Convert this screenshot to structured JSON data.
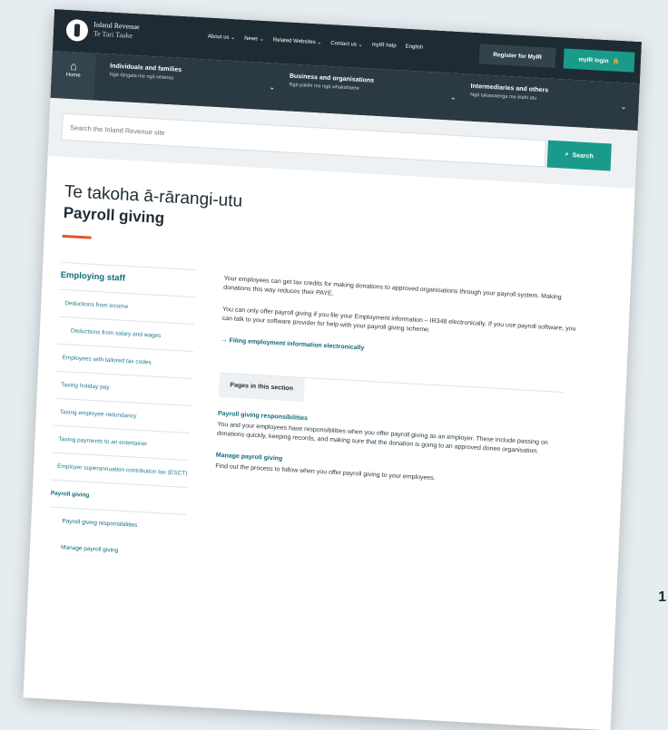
{
  "header": {
    "logo_title": "Inland Revenue",
    "logo_subtitle": "Te Tari Taake",
    "nav": [
      "About us ⌄",
      "News ⌄",
      "Related Websites ⌄",
      "Contact us ⌄",
      "myIR help",
      "English"
    ],
    "register_label": "Register for MyIR",
    "login_label": "myIR login"
  },
  "categories": {
    "home_label": "Home",
    "items": [
      {
        "title": "Individuals and families",
        "subtitle": "Ngā tāngata me ngā whānau"
      },
      {
        "title": "Business and organisations",
        "subtitle": "Ngā pakihi me ngā whakahaere"
      },
      {
        "title": "Intermediaries and others",
        "subtitle": "Ngā takawaenga me ētahi atu"
      }
    ]
  },
  "search": {
    "placeholder": "Search the Inland Revenue site",
    "button_label": "Search"
  },
  "title": {
    "maori": "Te takoha ā-rārangi-utu",
    "english": "Payroll giving"
  },
  "sidebar": {
    "heading": "Employing staff",
    "items": [
      "Deductions from income",
      "Deductions from salary and wages",
      "Employees with tailored tax codes",
      "Taxing holiday pay",
      "Taxing employee redundancy",
      "Taxing payments to an entertainer",
      "Employer superannuation contribution tax (ESCT)",
      "Payroll giving",
      "Payroll giving responsibilities",
      "Manage payroll giving"
    ]
  },
  "main": {
    "para1": "Your employees can get tax credits for making donations to approved organisations through your payroll system. Making donations this way reduces their PAYE.",
    "para2": "You can only offer payroll giving if you file your Employment information – IR348 electronically. If you use payroll software, you can talk to your software provider for help with your payroll giving scheme.",
    "link": "Filing employment information electronically",
    "pages_heading": "Pages in this section",
    "entries": [
      {
        "title": "Payroll giving responsibilities",
        "desc": "You and your employees have responsibilities when you offer payroll giving as an employer. These include passing on donations quickly, keeping records, and making sure that the donation is going to an approved donee organisation."
      },
      {
        "title": "Manage payroll giving",
        "desc": "Find out the process to follow when you offer payroll giving to your employees."
      }
    ]
  },
  "corner_number": "1"
}
